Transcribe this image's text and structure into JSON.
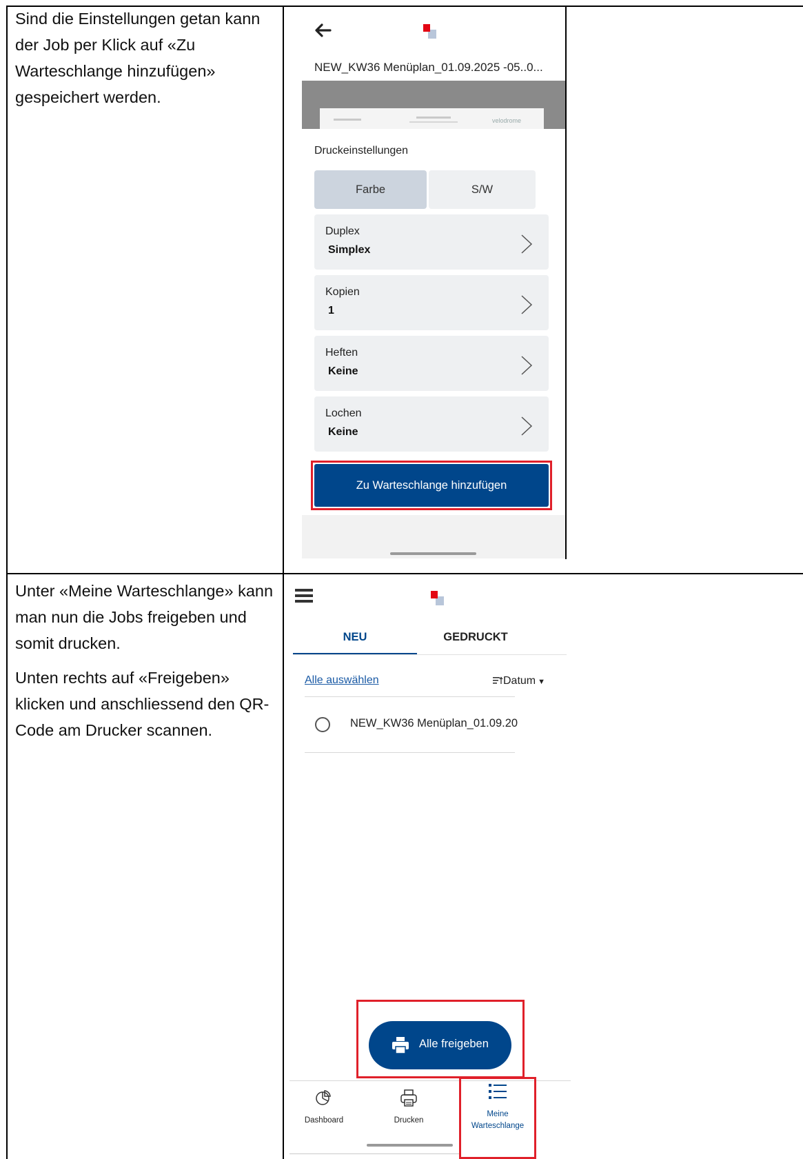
{
  "rows": [
    {
      "paragraphs": [
        "Sind die Einstellungen getan kann der Job per Klick auf «Zu Warteschlange hinzufügen» gespeichert werden."
      ]
    },
    {
      "paragraphs": [
        "Unter «Meine Warteschlange» kann man nun die Jobs freigeben und somit drucken.",
        "Unten rechts auf «Freigeben» klicken und anschliessend den QR-Code am Drucker scannen."
      ]
    }
  ],
  "print_screen": {
    "file_title": "NEW_KW36 Menüplan_01.09.2025 -05..0...",
    "section_title": "Druckeinstellungen",
    "color_options": [
      "Farbe",
      "S/W"
    ],
    "selected_color": "Farbe",
    "settings": [
      {
        "label": "Duplex",
        "value": "Simplex"
      },
      {
        "label": "Kopien",
        "value": "1"
      },
      {
        "label": "Heften",
        "value": "Keine"
      },
      {
        "label": "Lochen",
        "value": "Keine"
      }
    ],
    "add_button": "Zu Warteschlange hinzufügen",
    "preview": {
      "brand": "velodrome"
    }
  },
  "queue_screen": {
    "tabs": [
      "NEU",
      "GEDRUCKT"
    ],
    "active_tab": "NEU",
    "select_all": "Alle auswählen",
    "sort_label": "Datum",
    "jobs": [
      "NEW_KW36 Menüplan_01.09.20"
    ],
    "release_button": "Alle freigeben",
    "nav": {
      "dashboard": "Dashboard",
      "print": "Drucken",
      "queue_line1": "Meine",
      "queue_line2": "Warteschlange"
    }
  },
  "colors": {
    "accent_blue": "#00468b",
    "highlight_red": "#e0202a",
    "logo_red": "#e30613",
    "card_grey": "#eef0f2"
  },
  "icons": [
    "back-arrow-icon",
    "app-logo-icon",
    "chevron-right-icon",
    "hamburger-menu-icon",
    "sort-icon",
    "radio-icon",
    "printer-icon",
    "pie-chart-icon",
    "list-icon"
  ]
}
